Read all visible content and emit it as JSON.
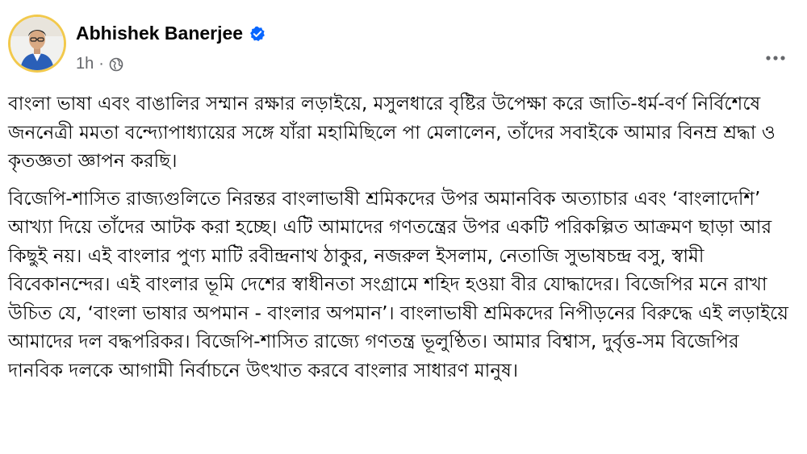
{
  "post": {
    "author": {
      "name": "Abhishek Banerjee",
      "verified": true,
      "verified_icon": "verified-badge-icon",
      "avatar": "profile-photo"
    },
    "time": "1h",
    "separator": "·",
    "audience_icon": "globe-icon",
    "more_icon": "more-options-icon",
    "paragraphs": [
      "বাংলা ভাষা এবং বাঙালির সম্মান রক্ষার লড়াইয়ে, মসুলধারে বৃষ্টির উপেক্ষা করে জাতি-ধর্ম-বর্ণ নির্বিশেষে জননেত্রী মমতা বন্দ্যোপাধ্যায়ের সঙ্গে যাঁরা মহামিছিলে পা মেলালেন, তাঁদের সবাইকে আমার বিনম্র শ্রদ্ধা ও কৃতজ্ঞতা জ্ঞাপন করছি।",
      "বিজেপি-শাসিত রাজ্যগুলিতে নিরন্তর বাংলাভাষী শ্রমিকদের উপর অমানবিক অত্যাচার এবং ‘বাংলাদেশি’ আখ্যা দিয়ে তাঁদের আটক করা হচ্ছে। এটি আমাদের গণতন্ত্রের উপর একটি পরিকল্পিত আক্রমণ ছাড়া আর কিছুই নয়। এই বাংলার পুণ্য মাটি রবীন্দ্রনাথ ঠাকুর, নজরুল ইসলাম, নেতাজি সুভাষচন্দ্র বসু, স্বামী বিবেকানন্দের। এই বাংলার ভূমি  দেশের স্বাধীনতা সংগ্রামে শহিদ হওয়া বীর যোদ্ধাদের। বিজেপির মনে রাখা উচিত যে, ‘বাংলা ভাষার অপমান - বাংলার অপমান’। বাংলাভাষী শ্রমিকদের নিপীড়নের বিরুদ্ধে এই লড়াইয়ে আমাদের দল বদ্ধপরিকর। বিজেপি-শাসিত রাজ্যে গণতন্ত্র ভূলুণ্ঠিত। আমার বিশ্বাস, দুর্বৃত্ত-সম বিজেপির দানবিক দলকে আগামী নির্বাচনে উৎখাত করবে বাংলার সাধারণ মানুষ।"
    ]
  },
  "colors": {
    "text": "#050505",
    "secondary_text": "#65676b",
    "verified_blue": "#0866ff",
    "avatar_ring": "#f2c94c",
    "background": "#ffffff"
  }
}
